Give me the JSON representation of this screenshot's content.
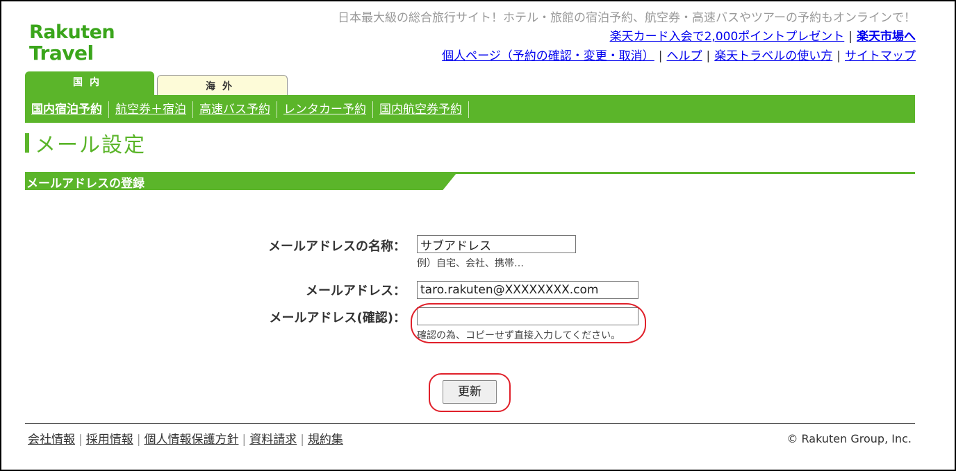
{
  "logo": {
    "line1": "Rakuten",
    "line2": "Travel"
  },
  "header": {
    "tagline": "日本最大級の総合旅行サイト！ホテル・旅館の宿泊予約、航空券・高速バスやツアーの予約もオンラインで！",
    "promo_link": "楽天カード入会で2,000ポイントプレゼント",
    "ichiba_link": "楽天市場へ",
    "mypage_link": "個人ページ（予約の確認・変更・取消）",
    "help_link": "ヘルプ",
    "howto_link": "楽天トラベルの使い方",
    "sitemap_link": "サイトマップ"
  },
  "tabs": {
    "domestic": "国内",
    "overseas": "海外"
  },
  "subnav": [
    "国内宿泊予約",
    "航空券＋宿泊",
    "高速バス予約",
    "レンタカー予約",
    "国内航空券予約"
  ],
  "page_title": "メール設定",
  "section_title": "メールアドレスの登録",
  "form": {
    "name_label": "メールアドレスの名称：",
    "name_value": "サブアドレス",
    "name_hint": "例）自宅、会社、携帯…",
    "email_label": "メールアドレス：",
    "email_value": "taro.rakuten@XXXXXXXX.com",
    "confirm_label": "メールアドレス(確認)：",
    "confirm_value": "",
    "confirm_hint": "確認の為、コピーせず直接入力してください。",
    "submit_label": "更新"
  },
  "footer": {
    "links": [
      "会社情報",
      "採用情報",
      "個人情報保護方針",
      "資料請求",
      "規約集"
    ],
    "copyright": "© Rakuten Group, Inc."
  },
  "colors": {
    "brand_green": "#5bb52a",
    "logo_green": "#3aa51b",
    "callout_red": "#e0202a",
    "link_blue": "#0000ee"
  }
}
